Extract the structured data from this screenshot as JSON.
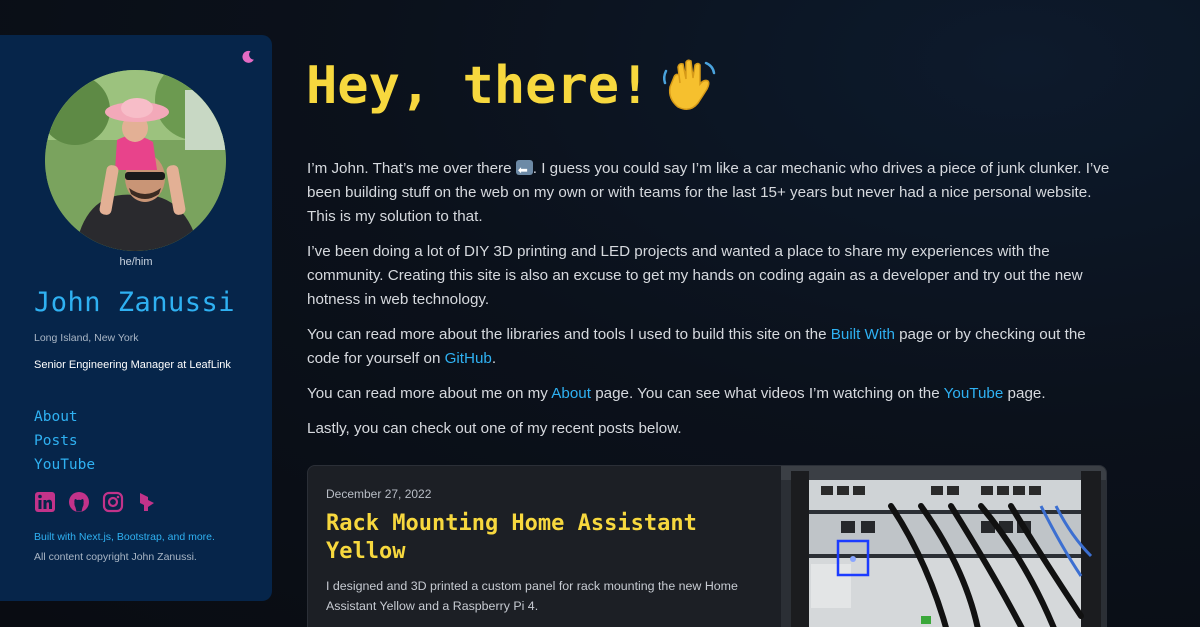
{
  "sidebar": {
    "pronouns": "he/him",
    "name": "John Zanussi",
    "location": "Long Island, New York",
    "job": "Senior Engineering Manager at LeafLink",
    "nav": [
      {
        "label": "About"
      },
      {
        "label": "Posts"
      },
      {
        "label": "YouTube"
      }
    ],
    "socials": [
      "linkedin-icon",
      "github-icon",
      "instagram-icon",
      "brand-icon"
    ],
    "built_with": "Built with Next.js, Bootstrap, and more.",
    "copyright": "All content copyright John Zanussi.",
    "theme_toggle_icon": "moon-icon"
  },
  "main": {
    "title": "Hey, there!",
    "title_emoji": "waving-hand-icon",
    "p1_a": "I’m John. That’s me over there ",
    "p1_b": ". I guess you could say I’m like a car mechanic who drives a piece of junk clunker. I’ve been building stuff on the web on my own or with teams for the last 15+ years but never had a nice personal website. This is my solution to that.",
    "p2": "I’ve been doing a lot of DIY 3D printing and LED projects and wanted a place to share my experiences with the community. Creating this site is also an excuse to get my hands on coding again as a developer and try out the new hotness in web technology.",
    "p3_a": "You can read more about the libraries and tools I used to build this site on the ",
    "p3_link1": "Built With",
    "p3_b": " page or by checking out the code for yourself on ",
    "p3_link2": "GitHub",
    "p3_c": ".",
    "p4_a": "You can read more about me on my ",
    "p4_link1": "About",
    "p4_b": " page. You can see what videos I’m watching on the ",
    "p4_link2": "YouTube",
    "p4_c": " page.",
    "p5": "Lastly, you can check out one of my recent posts below."
  },
  "post": {
    "date": "December 27, 2022",
    "title": "Rack Mounting Home Assistant Yellow",
    "description": "I designed and 3D printed a custom panel for rack mounting the new Home Assistant Yellow and a Raspberry Pi 4."
  },
  "colors": {
    "accent_blue": "#2fb1f2",
    "accent_yellow": "#f7d83e",
    "sidebar_bg": "#06254a",
    "social_pink": "#c2338a"
  }
}
